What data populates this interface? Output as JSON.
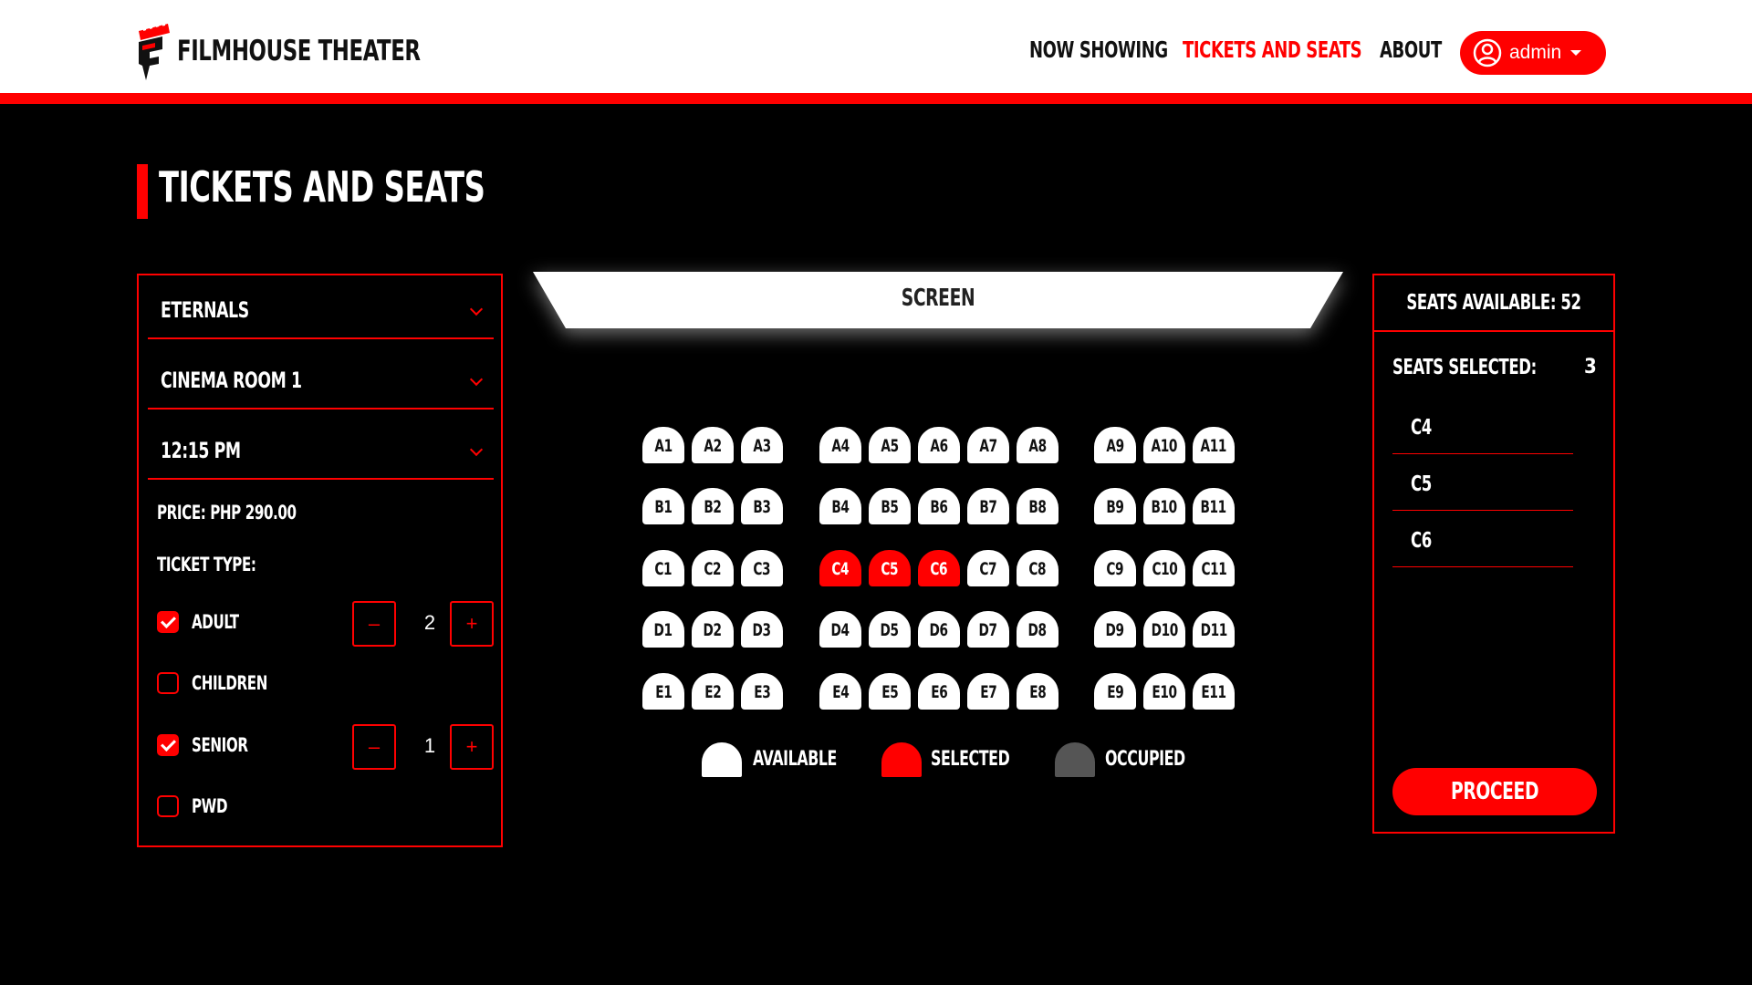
{
  "header": {
    "brand": "FILMHOUSE THEATER",
    "nav": [
      "NOW SHOWING",
      "TICKETS AND SEATS",
      "ABOUT"
    ],
    "active_nav": "TICKETS AND SEATS",
    "user_label": "admin"
  },
  "page_title": "TICKETS AND SEATS",
  "filters": {
    "movie": "ETERNALS",
    "cinema": "CINEMA ROOM 1",
    "time": "12:15 PM"
  },
  "price_label": "PRICE: PHP 290.00",
  "ticket_type_label": "TICKET TYPE:",
  "ticket_types": [
    {
      "name": "ADULT",
      "checked": true,
      "qty": "2"
    },
    {
      "name": "CHILDREN",
      "checked": false,
      "qty": ""
    },
    {
      "name": "SENIOR",
      "checked": true,
      "qty": "1"
    },
    {
      "name": "PWD",
      "checked": false,
      "qty": ""
    }
  ],
  "stepper": {
    "minus": "–",
    "plus": "+"
  },
  "screen_label": "SCREEN",
  "seats": {
    "rows": [
      [
        "A1",
        "A2",
        "A3",
        "A4",
        "A5",
        "A6",
        "A7",
        "A8",
        "A9",
        "A10",
        "A11"
      ],
      [
        "B1",
        "B2",
        "B3",
        "B4",
        "B5",
        "B6",
        "B7",
        "B8",
        "B9",
        "B10",
        "B11"
      ],
      [
        "C1",
        "C2",
        "C3",
        "C4",
        "C5",
        "C6",
        "C7",
        "C8",
        "C9",
        "C10",
        "C11"
      ],
      [
        "D1",
        "D2",
        "D3",
        "D4",
        "D5",
        "D6",
        "D7",
        "D8",
        "D9",
        "D10",
        "D11"
      ],
      [
        "E1",
        "E2",
        "E3",
        "E4",
        "E5",
        "E6",
        "E7",
        "E8",
        "E9",
        "E10",
        "E11"
      ]
    ],
    "selected": [
      "C4",
      "C5",
      "C6"
    ],
    "occupied": []
  },
  "legend": {
    "available": "AVAILABLE",
    "selected": "SELECTED",
    "occupied": "OCCUPIED"
  },
  "summary": {
    "seats_available": "SEATS AVAILABLE: 52",
    "seats_selected_label": "SEATS SELECTED:",
    "seats_selected_count": "3",
    "selected_list": [
      "C4",
      "C5",
      "C6"
    ],
    "proceed": "PROCEED"
  },
  "colors": {
    "accent": "#ff0000",
    "background": "#000000",
    "seat_available": "#ffffff",
    "seat_occupied": "#555555"
  }
}
